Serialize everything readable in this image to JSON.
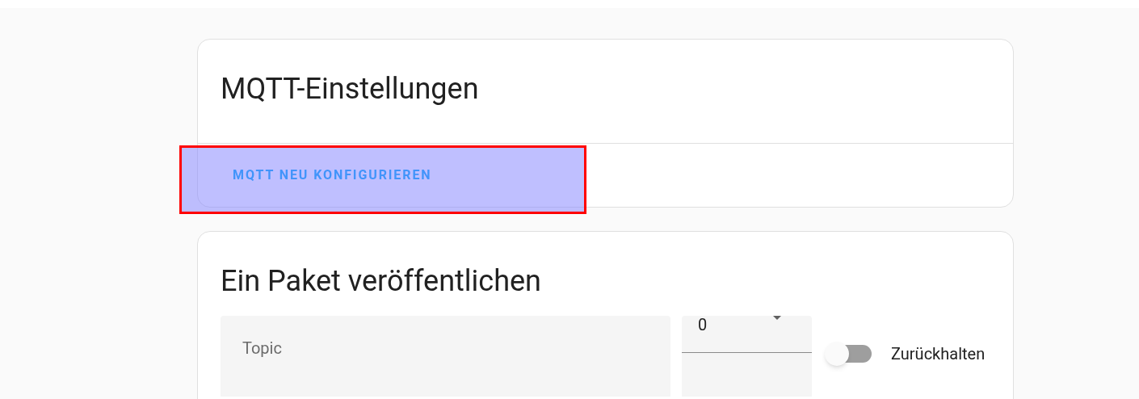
{
  "settings_card": {
    "title": "MQTT-Einstellungen",
    "button": "MQTT NEU KONFIGURIEREN",
    "highlighted": true
  },
  "publish_card": {
    "title": "Ein Paket veröffentlichen",
    "topic": {
      "placeholder": "Topic"
    },
    "qos": {
      "value": "0"
    },
    "retain": {
      "label": "Zurückhalten",
      "checked": false
    }
  }
}
